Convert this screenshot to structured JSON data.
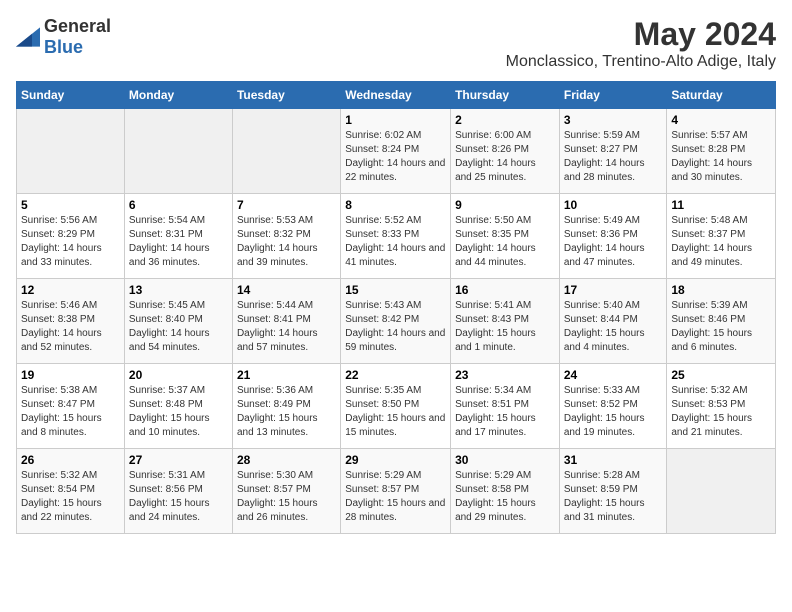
{
  "header": {
    "logo_general": "General",
    "logo_blue": "Blue",
    "month_title": "May 2024",
    "location": "Monclassico, Trentino-Alto Adige, Italy"
  },
  "weekdays": [
    "Sunday",
    "Monday",
    "Tuesday",
    "Wednesday",
    "Thursday",
    "Friday",
    "Saturday"
  ],
  "weeks": [
    [
      {
        "day": "",
        "sunrise": "",
        "sunset": "",
        "daylight": ""
      },
      {
        "day": "",
        "sunrise": "",
        "sunset": "",
        "daylight": ""
      },
      {
        "day": "",
        "sunrise": "",
        "sunset": "",
        "daylight": ""
      },
      {
        "day": "1",
        "sunrise": "Sunrise: 6:02 AM",
        "sunset": "Sunset: 8:24 PM",
        "daylight": "Daylight: 14 hours and 22 minutes."
      },
      {
        "day": "2",
        "sunrise": "Sunrise: 6:00 AM",
        "sunset": "Sunset: 8:26 PM",
        "daylight": "Daylight: 14 hours and 25 minutes."
      },
      {
        "day": "3",
        "sunrise": "Sunrise: 5:59 AM",
        "sunset": "Sunset: 8:27 PM",
        "daylight": "Daylight: 14 hours and 28 minutes."
      },
      {
        "day": "4",
        "sunrise": "Sunrise: 5:57 AM",
        "sunset": "Sunset: 8:28 PM",
        "daylight": "Daylight: 14 hours and 30 minutes."
      }
    ],
    [
      {
        "day": "5",
        "sunrise": "Sunrise: 5:56 AM",
        "sunset": "Sunset: 8:29 PM",
        "daylight": "Daylight: 14 hours and 33 minutes."
      },
      {
        "day": "6",
        "sunrise": "Sunrise: 5:54 AM",
        "sunset": "Sunset: 8:31 PM",
        "daylight": "Daylight: 14 hours and 36 minutes."
      },
      {
        "day": "7",
        "sunrise": "Sunrise: 5:53 AM",
        "sunset": "Sunset: 8:32 PM",
        "daylight": "Daylight: 14 hours and 39 minutes."
      },
      {
        "day": "8",
        "sunrise": "Sunrise: 5:52 AM",
        "sunset": "Sunset: 8:33 PM",
        "daylight": "Daylight: 14 hours and 41 minutes."
      },
      {
        "day": "9",
        "sunrise": "Sunrise: 5:50 AM",
        "sunset": "Sunset: 8:35 PM",
        "daylight": "Daylight: 14 hours and 44 minutes."
      },
      {
        "day": "10",
        "sunrise": "Sunrise: 5:49 AM",
        "sunset": "Sunset: 8:36 PM",
        "daylight": "Daylight: 14 hours and 47 minutes."
      },
      {
        "day": "11",
        "sunrise": "Sunrise: 5:48 AM",
        "sunset": "Sunset: 8:37 PM",
        "daylight": "Daylight: 14 hours and 49 minutes."
      }
    ],
    [
      {
        "day": "12",
        "sunrise": "Sunrise: 5:46 AM",
        "sunset": "Sunset: 8:38 PM",
        "daylight": "Daylight: 14 hours and 52 minutes."
      },
      {
        "day": "13",
        "sunrise": "Sunrise: 5:45 AM",
        "sunset": "Sunset: 8:40 PM",
        "daylight": "Daylight: 14 hours and 54 minutes."
      },
      {
        "day": "14",
        "sunrise": "Sunrise: 5:44 AM",
        "sunset": "Sunset: 8:41 PM",
        "daylight": "Daylight: 14 hours and 57 minutes."
      },
      {
        "day": "15",
        "sunrise": "Sunrise: 5:43 AM",
        "sunset": "Sunset: 8:42 PM",
        "daylight": "Daylight: 14 hours and 59 minutes."
      },
      {
        "day": "16",
        "sunrise": "Sunrise: 5:41 AM",
        "sunset": "Sunset: 8:43 PM",
        "daylight": "Daylight: 15 hours and 1 minute."
      },
      {
        "day": "17",
        "sunrise": "Sunrise: 5:40 AM",
        "sunset": "Sunset: 8:44 PM",
        "daylight": "Daylight: 15 hours and 4 minutes."
      },
      {
        "day": "18",
        "sunrise": "Sunrise: 5:39 AM",
        "sunset": "Sunset: 8:46 PM",
        "daylight": "Daylight: 15 hours and 6 minutes."
      }
    ],
    [
      {
        "day": "19",
        "sunrise": "Sunrise: 5:38 AM",
        "sunset": "Sunset: 8:47 PM",
        "daylight": "Daylight: 15 hours and 8 minutes."
      },
      {
        "day": "20",
        "sunrise": "Sunrise: 5:37 AM",
        "sunset": "Sunset: 8:48 PM",
        "daylight": "Daylight: 15 hours and 10 minutes."
      },
      {
        "day": "21",
        "sunrise": "Sunrise: 5:36 AM",
        "sunset": "Sunset: 8:49 PM",
        "daylight": "Daylight: 15 hours and 13 minutes."
      },
      {
        "day": "22",
        "sunrise": "Sunrise: 5:35 AM",
        "sunset": "Sunset: 8:50 PM",
        "daylight": "Daylight: 15 hours and 15 minutes."
      },
      {
        "day": "23",
        "sunrise": "Sunrise: 5:34 AM",
        "sunset": "Sunset: 8:51 PM",
        "daylight": "Daylight: 15 hours and 17 minutes."
      },
      {
        "day": "24",
        "sunrise": "Sunrise: 5:33 AM",
        "sunset": "Sunset: 8:52 PM",
        "daylight": "Daylight: 15 hours and 19 minutes."
      },
      {
        "day": "25",
        "sunrise": "Sunrise: 5:32 AM",
        "sunset": "Sunset: 8:53 PM",
        "daylight": "Daylight: 15 hours and 21 minutes."
      }
    ],
    [
      {
        "day": "26",
        "sunrise": "Sunrise: 5:32 AM",
        "sunset": "Sunset: 8:54 PM",
        "daylight": "Daylight: 15 hours and 22 minutes."
      },
      {
        "day": "27",
        "sunrise": "Sunrise: 5:31 AM",
        "sunset": "Sunset: 8:56 PM",
        "daylight": "Daylight: 15 hours and 24 minutes."
      },
      {
        "day": "28",
        "sunrise": "Sunrise: 5:30 AM",
        "sunset": "Sunset: 8:57 PM",
        "daylight": "Daylight: 15 hours and 26 minutes."
      },
      {
        "day": "29",
        "sunrise": "Sunrise: 5:29 AM",
        "sunset": "Sunset: 8:57 PM",
        "daylight": "Daylight: 15 hours and 28 minutes."
      },
      {
        "day": "30",
        "sunrise": "Sunrise: 5:29 AM",
        "sunset": "Sunset: 8:58 PM",
        "daylight": "Daylight: 15 hours and 29 minutes."
      },
      {
        "day": "31",
        "sunrise": "Sunrise: 5:28 AM",
        "sunset": "Sunset: 8:59 PM",
        "daylight": "Daylight: 15 hours and 31 minutes."
      },
      {
        "day": "",
        "sunrise": "",
        "sunset": "",
        "daylight": ""
      }
    ]
  ]
}
